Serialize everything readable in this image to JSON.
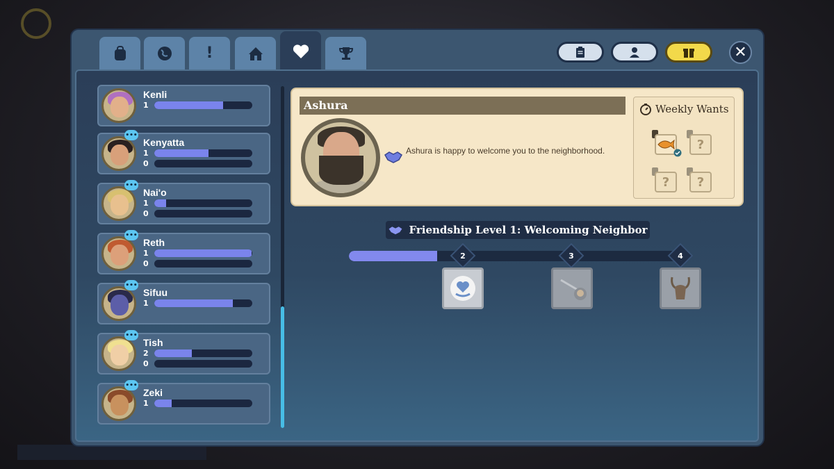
{
  "tabs": [
    {
      "icon": "backpack-icon",
      "active": false
    },
    {
      "icon": "globe-icon",
      "active": false
    },
    {
      "icon": "exclamation-icon",
      "active": false,
      "label": "!"
    },
    {
      "icon": "house-icon",
      "active": false
    },
    {
      "icon": "heart-icon",
      "active": true
    },
    {
      "icon": "trophy-icon",
      "active": false
    }
  ],
  "top_buttons": [
    {
      "icon": "clipboard-icon"
    },
    {
      "icon": "character-icon"
    },
    {
      "icon": "gift-icon",
      "highlighted": true
    }
  ],
  "close_label": "✕",
  "villagers": [
    {
      "name": "Kenli",
      "bars": [
        {
          "level": "1",
          "progress": 0.7
        }
      ],
      "chat": false
    },
    {
      "name": "Kenyatta",
      "bars": [
        {
          "level": "1",
          "progress": 0.55
        },
        {
          "level": "0",
          "progress": 0
        }
      ],
      "chat": true
    },
    {
      "name": "Nai'o",
      "bars": [
        {
          "level": "1",
          "progress": 0.12
        },
        {
          "level": "0",
          "progress": 0
        }
      ],
      "chat": true
    },
    {
      "name": "Reth",
      "bars": [
        {
          "level": "1",
          "progress": 0.99
        },
        {
          "level": "0",
          "progress": 0
        }
      ],
      "chat": true
    },
    {
      "name": "Sifuu",
      "bars": [
        {
          "level": "1",
          "progress": 0.8
        }
      ],
      "chat": true
    },
    {
      "name": "Tish",
      "bars": [
        {
          "level": "2",
          "progress": 0.38
        },
        {
          "level": "0",
          "progress": 0
        }
      ],
      "chat": true
    },
    {
      "name": "Zeki",
      "bars": [
        {
          "level": "1",
          "progress": 0.18
        }
      ],
      "chat": true
    }
  ],
  "detail": {
    "name": "Ashura",
    "message": "Ashura is happy to welcome you to the neighborhood.",
    "weekly_wants_title": "Weekly Wants",
    "wants": [
      {
        "item": "fish-icon",
        "known": true,
        "delivered": true
      },
      {
        "item": "unknown",
        "known": false,
        "label": "?"
      },
      {
        "item": "unknown",
        "known": false,
        "label": "?"
      },
      {
        "item": "unknown",
        "known": false,
        "label": "?"
      }
    ]
  },
  "friendship": {
    "title": "Friendship Level 1: Welcoming Neighbor",
    "progress": 0.26,
    "milestones": [
      {
        "level": "2",
        "reward": "heart-recipe-icon",
        "unlocked": true
      },
      {
        "level": "3",
        "reward": "tool-icon",
        "unlocked": false
      },
      {
        "level": "4",
        "reward": "antler-helmet-icon",
        "unlocked": false
      }
    ]
  }
}
